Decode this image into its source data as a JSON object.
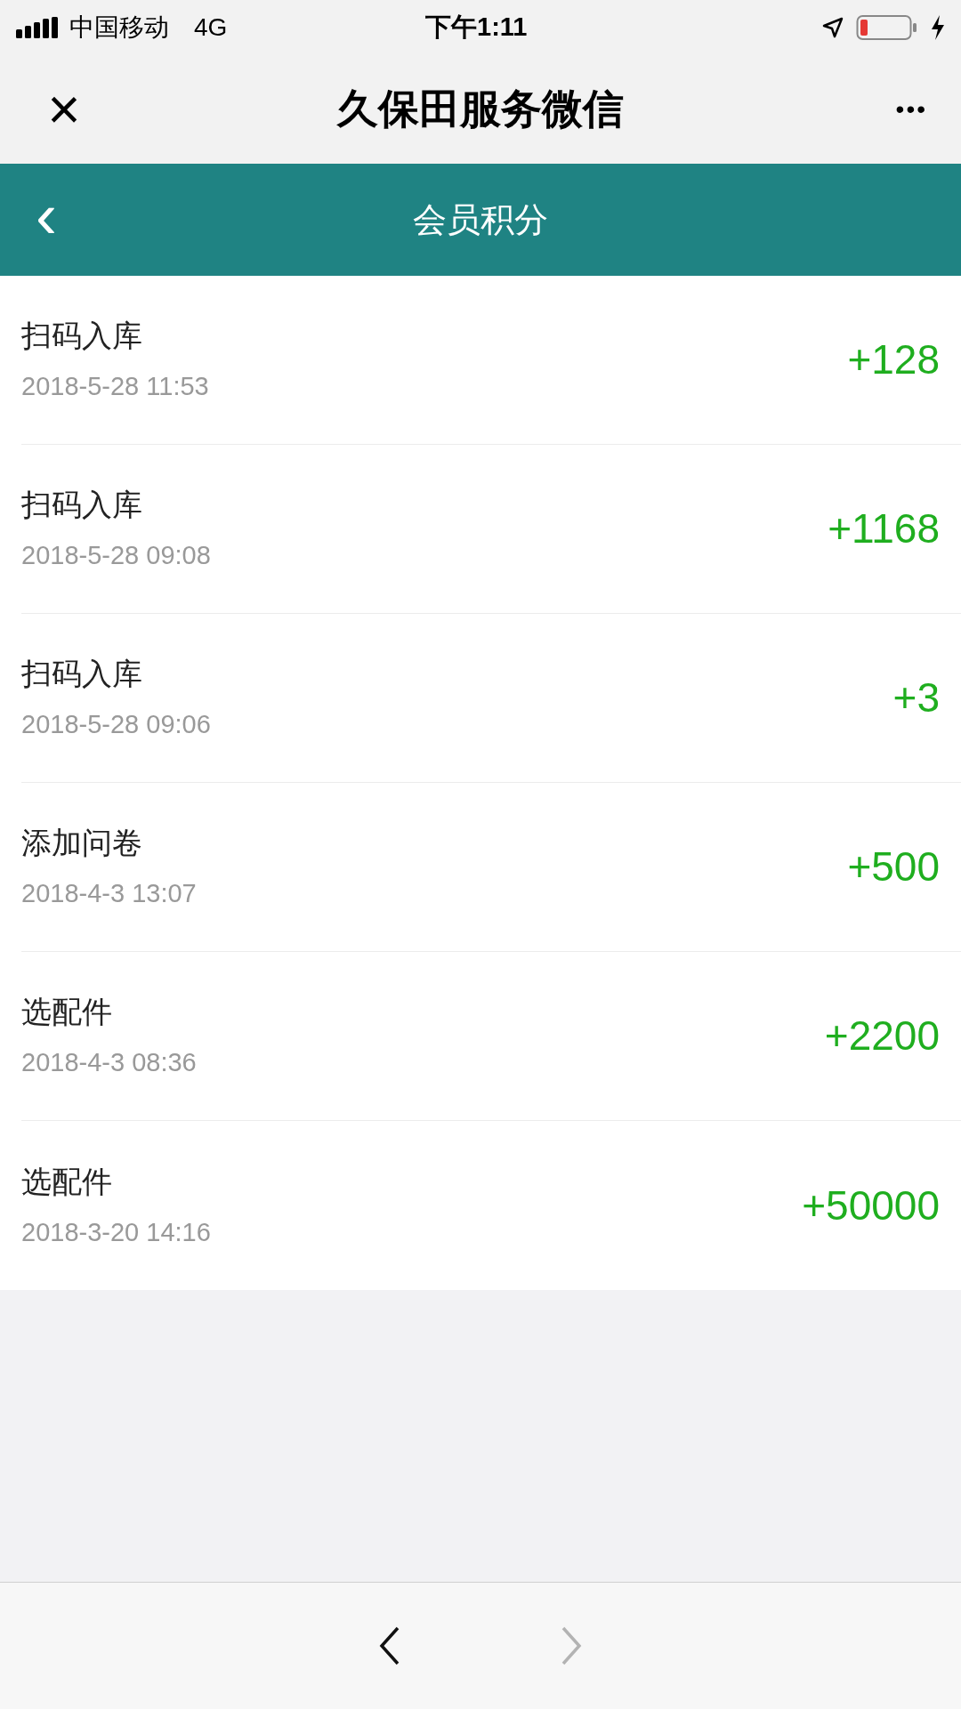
{
  "status_bar": {
    "carrier": "中国移动",
    "network": "4G",
    "time": "下午1:11"
  },
  "wechat_header": {
    "close": "×",
    "title": "久保田服务微信",
    "more": "•••"
  },
  "page_header": {
    "back": "‹",
    "title": "会员积分"
  },
  "records": [
    {
      "title": "扫码入库",
      "time": "2018-5-28 11:53",
      "points": "+128"
    },
    {
      "title": "扫码入库",
      "time": "2018-5-28 09:08",
      "points": "+1168"
    },
    {
      "title": "扫码入库",
      "time": "2018-5-28 09:06",
      "points": "+3"
    },
    {
      "title": "添加问卷",
      "time": "2018-4-3 13:07",
      "points": "+500"
    },
    {
      "title": "选配件",
      "time": "2018-4-3 08:36",
      "points": "+2200"
    },
    {
      "title": "选配件",
      "time": "2018-3-20 14:16",
      "points": "+50000"
    }
  ],
  "bottom_nav": [
    {
      "kind": "back",
      "disabled": false
    },
    {
      "kind": "forward",
      "disabled": true
    }
  ]
}
